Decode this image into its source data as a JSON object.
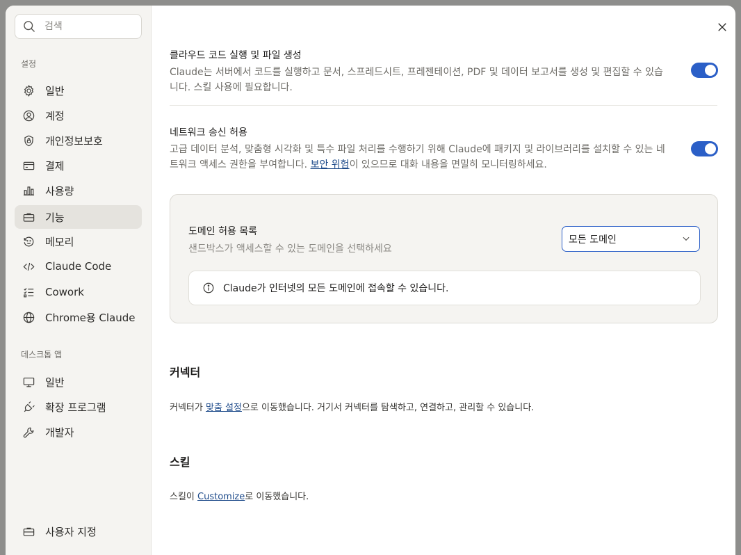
{
  "search": {
    "placeholder": "검색"
  },
  "sidebar": {
    "settings_label": "설정",
    "items": [
      {
        "label": "일반",
        "icon": "gear-icon"
      },
      {
        "label": "계정",
        "icon": "user-circle-icon"
      },
      {
        "label": "개인정보보호",
        "icon": "shield-lock-icon"
      },
      {
        "label": "결제",
        "icon": "credit-card-icon"
      },
      {
        "label": "사용량",
        "icon": "bar-chart-icon"
      },
      {
        "label": "기능",
        "icon": "briefcase-icon"
      },
      {
        "label": "메모리",
        "icon": "history-icon"
      },
      {
        "label": "Claude Code",
        "icon": "code-icon"
      },
      {
        "label": "Cowork",
        "icon": "checklist-icon"
      },
      {
        "label": "Chrome용 Claude",
        "icon": "globe-icon"
      }
    ],
    "desktop_label": "데스크톱 앱",
    "desktop_items": [
      {
        "label": "일반",
        "icon": "monitor-icon"
      },
      {
        "label": "확장 프로그램",
        "icon": "plugin-icon"
      },
      {
        "label": "개발자",
        "icon": "wrench-icon"
      }
    ],
    "footer_item": {
      "label": "사용자 지정",
      "icon": "briefcase-icon"
    }
  },
  "settings": {
    "code_exec": {
      "title": "클라우드 코드 실행 및 파일 생성",
      "desc": "Claude는 서버에서 코드를 실행하고 문서, 스프레드시트, 프레젠테이션, PDF 및 데이터 보고서를 생성 및 편집할 수 있습니다. 스킬 사용에 필요합니다.",
      "enabled": true
    },
    "network": {
      "title": "네트워크 송신 허용",
      "desc_before": "고급 데이터 분석, 맞춤형 시각화 및 특수 파일 처리를 수행하기 위해 Claude에 패키지 및 라이브러리를 설치할 수 있는 네트워크 액세스 권한을 부여합니다. ",
      "desc_link": "보안 위험",
      "desc_after": "이 있으므로 대화 내용을 면밀히 모니터링하세요.",
      "enabled": true
    },
    "domain": {
      "title": "도메인 허용 목록",
      "desc": "샌드박스가 액세스할 수 있는 도메인을 선택하세요",
      "selected": "모든 도메인",
      "info": "Claude가 인터넷의 모든 도메인에 접속할 수 있습니다."
    }
  },
  "connectors": {
    "title": "커넥터",
    "text_before": "커넥터가 ",
    "link": "맞춤 설정",
    "text_after": "으로 이동했습니다. 거기서 커넥터를 탐색하고, 연결하고, 관리할 수 있습니다."
  },
  "skills": {
    "title": "스킬",
    "text_before": "스킬이 ",
    "link": "Customize",
    "text_after": "로 이동했습니다."
  },
  "colors": {
    "accent": "#2b5fc7",
    "link": "#1d4a8a",
    "sidebar_bg": "#f5f4f1",
    "active_bg": "#e5e3de"
  }
}
